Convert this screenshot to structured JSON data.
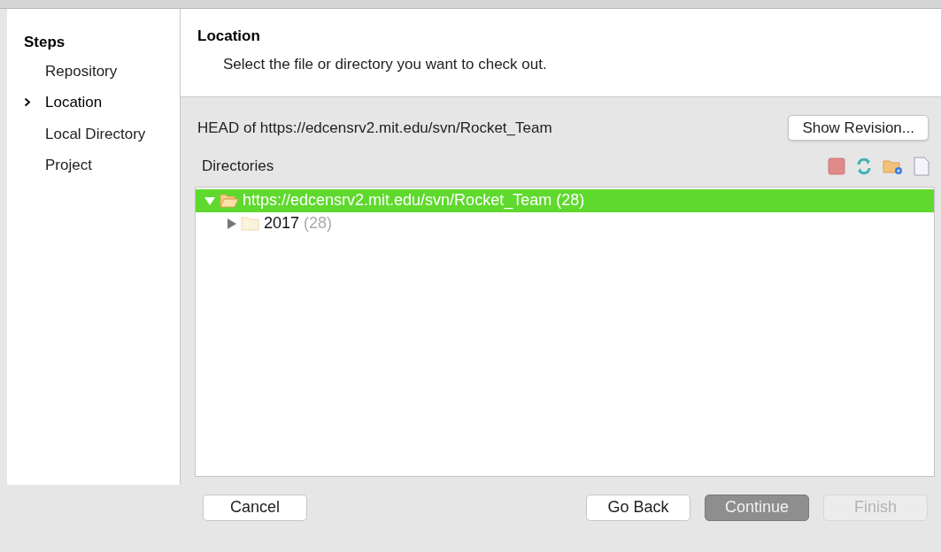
{
  "steps": {
    "title": "Steps",
    "items": [
      {
        "label": "Repository",
        "selected": false
      },
      {
        "label": "Location",
        "selected": true
      },
      {
        "label": "Local Directory",
        "selected": false
      },
      {
        "label": "Project",
        "selected": false
      }
    ]
  },
  "header": {
    "title": "Location",
    "description": "Select the file or directory you want to check out."
  },
  "revision": {
    "label": "HEAD of https://edcensrv2.mit.edu/svn/Rocket_Team",
    "button": "Show Revision..."
  },
  "directories": {
    "label": "Directories",
    "tree": [
      {
        "label": "https://edcensrv2.mit.edu/svn/Rocket_Team",
        "count": "(28)",
        "expanded": true,
        "selected": true,
        "children": [
          {
            "label": "2017",
            "count": "(28)",
            "expanded": false,
            "selected": false
          }
        ]
      }
    ]
  },
  "buttons": [
    {
      "label": "Cancel",
      "default": false,
      "disabled": false
    },
    {
      "label": "Go Back",
      "default": false,
      "disabled": false
    },
    {
      "label": "Continue",
      "default": true,
      "disabled": false
    },
    {
      "label": "Finish",
      "default": false,
      "disabled": true
    }
  ]
}
